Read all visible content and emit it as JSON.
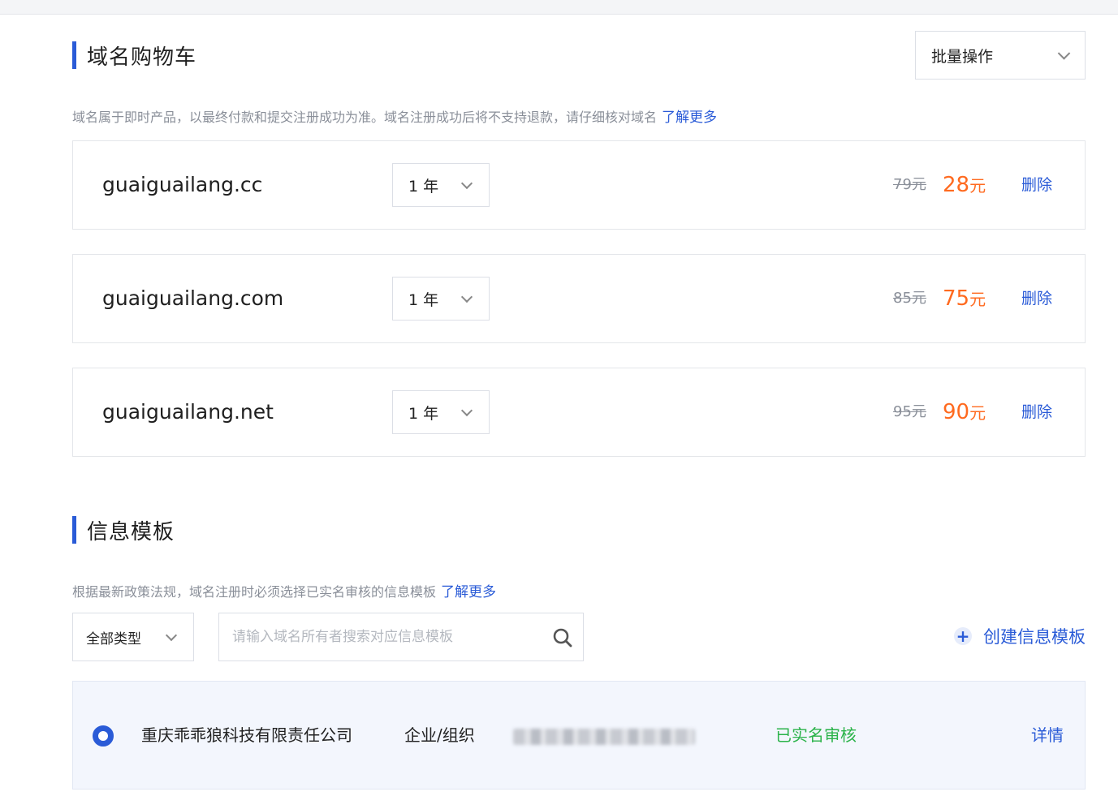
{
  "cart": {
    "title": "域名购物车",
    "batch_label": "批量操作",
    "notice": "域名属于即时产品，以最终付款和提交注册成功为准。域名注册成功后将不支持退款，请仔细核对域名",
    "learn_more": "了解更多",
    "items": [
      {
        "domain": "guaiguailang.cc",
        "years": "1 年",
        "price_old": "79元",
        "price_new": "28",
        "unit": "元",
        "delete": "删除"
      },
      {
        "domain": "guaiguailang.com",
        "years": "1 年",
        "price_old": "85元",
        "price_new": "75",
        "unit": "元",
        "delete": "删除"
      },
      {
        "domain": "guaiguailang.net",
        "years": "1 年",
        "price_old": "95元",
        "price_new": "90",
        "unit": "元",
        "delete": "删除"
      }
    ]
  },
  "template": {
    "title": "信息模板",
    "notice": "根据最新政策法规，域名注册时必须选择已实名审核的信息模板",
    "learn_more": "了解更多",
    "type_select": "全部类型",
    "search_placeholder": "请输入域名所有者搜索对应信息模板",
    "create_label": "创建信息模板",
    "row": {
      "owner": "重庆乖乖狼科技有限责任公司",
      "type": "企业/组织",
      "status": "已实名审核",
      "detail": "详情"
    }
  },
  "colors": {
    "accent": "#2a5bd7",
    "price": "#ff6a1f",
    "verified": "#2bb34a"
  }
}
